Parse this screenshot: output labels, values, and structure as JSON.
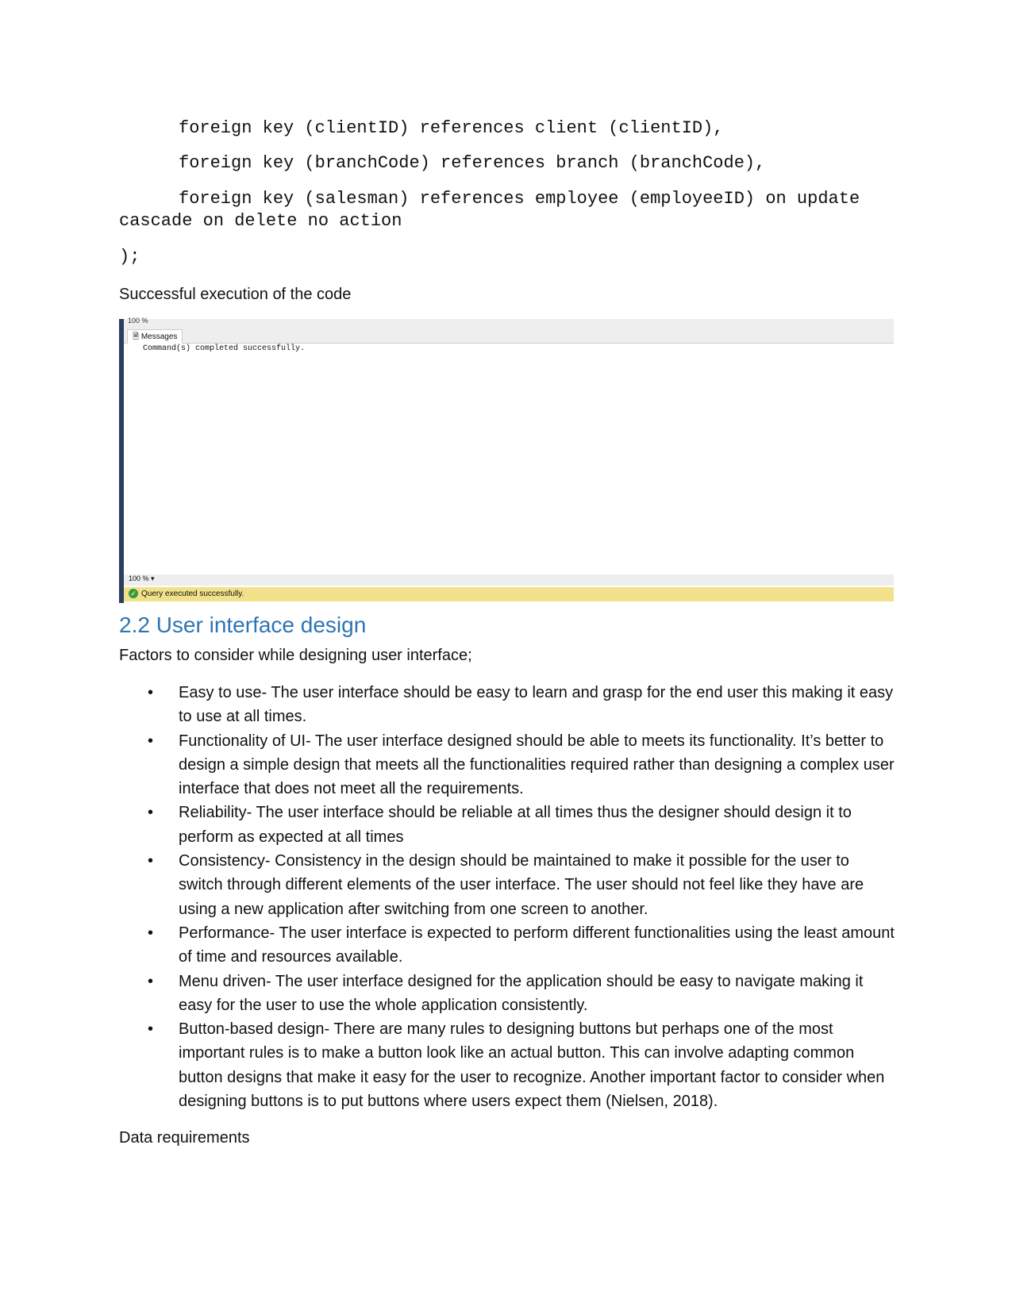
{
  "code": [
    "foreign key (clientID) references client (clientID),",
    "foreign key (branchCode) references branch (branchCode),",
    "foreign key (salesman) references employee (employeeID) on update cascade on delete no action",
    ");"
  ],
  "caption": "Successful execution of the code",
  "screenshot": {
    "zoom_top": "100 %",
    "tab": "Messages",
    "message": "Command(s) completed successfully.",
    "zoom_bottom": "100 %",
    "status": "Query executed successfully."
  },
  "heading": "2.2 User interface design",
  "intro": "Factors to consider while designing user interface;",
  "bullets": [
    "Easy to use- The user interface should be easy to learn and grasp for the end user this making it easy to use at all times.",
    "Functionality of UI- The user interface designed should be able to meets its functionality. It’s better to design a simple design that meets all the functionalities required rather than designing a complex user interface that does not meet all the requirements.",
    "Reliability- The user interface should be reliable at all times thus the designer should design it to perform as expected at all times",
    "Consistency- Consistency in the design should be maintained to make it possible for the user to switch through different elements of the user interface. The user should not feel like they have are using a new application after switching from one screen to another.",
    "Performance- The user interface is expected to perform different functionalities using the least amount of time and resources available.",
    "Menu driven- The user interface designed for the application should be easy to navigate making it easy for the user to use the whole application consistently.",
    "Button-based design- There are many rules to designing buttons but perhaps one of the most important rules is to make a button look like an actual button. This can involve adapting common button designs that make it easy for the user to recognize. Another important factor to consider when designing buttons is to put buttons where users expect them (Nielsen, 2018)."
  ],
  "footer_text": "Data requirements"
}
